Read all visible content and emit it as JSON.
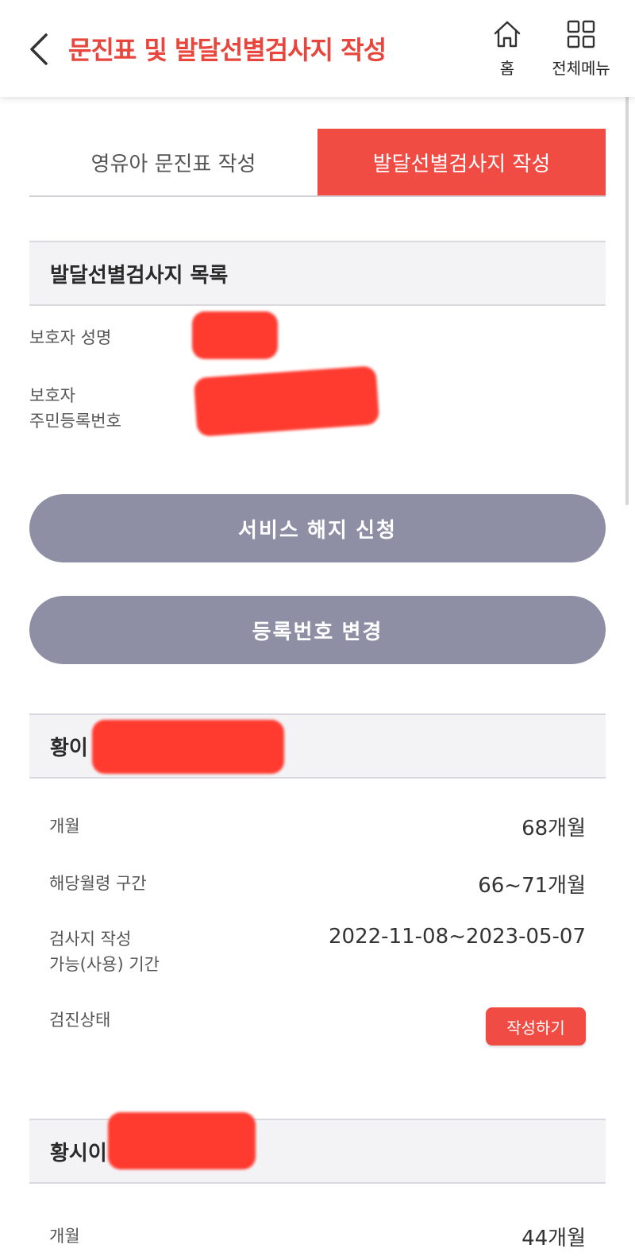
{
  "header": {
    "title": "문진표 및 발달선별검사지 작성",
    "home_label": "홈",
    "menu_label": "전체메뉴"
  },
  "tabs": [
    {
      "label": "영유아 문진표 작성",
      "active": false
    },
    {
      "label": "발달선별검사지 작성",
      "active": true
    }
  ],
  "list_section": {
    "title": "발달선별검사지 목록",
    "guardian_name_label": "보호자 성명",
    "guardian_id_label_line1": "보호자",
    "guardian_id_label_line2": "주민등록번호"
  },
  "buttons": {
    "cancel_service": "서비스 해지 신청",
    "change_reg_no": "등록번호 변경"
  },
  "children": [
    {
      "name_prefix": "황이",
      "age_label": "개월",
      "age_value": "68개월",
      "range_label": "해당월령 구간",
      "range_value": "66~71개월",
      "period_label_line1": "검사지 작성",
      "period_label_line2": "가능(사용) 기간",
      "period_value": "2022-11-08~2023-05-07",
      "status_label": "검진상태",
      "status_button": "작성하기"
    },
    {
      "name_prefix": "황시이",
      "age_label": "개월",
      "age_value": "44개월"
    }
  ],
  "colors": {
    "accent": "#f04c43",
    "pill": "#8e8ea5",
    "section_bg": "#f3f3f6"
  }
}
